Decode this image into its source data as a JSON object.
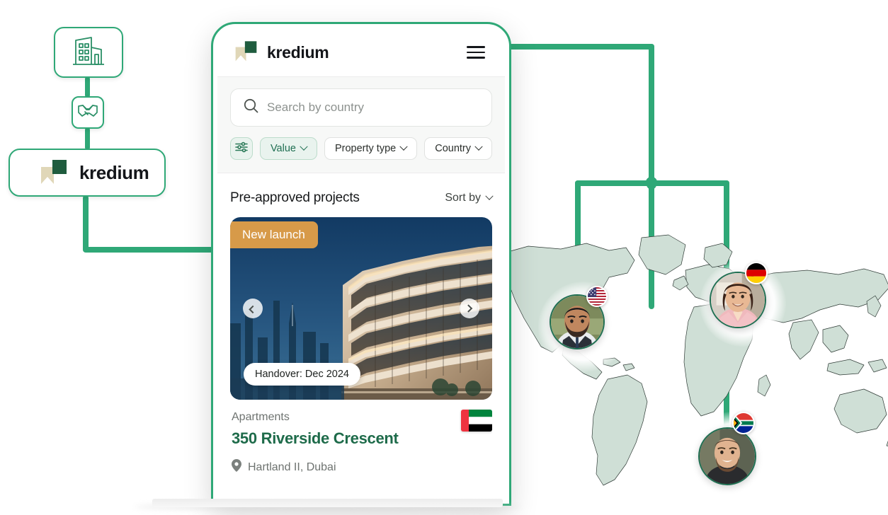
{
  "brand": {
    "name": "kredium",
    "accent": "#2fa877",
    "logo_dark": "#1f5c3e",
    "logo_light": "#e3dbbf"
  },
  "diagram": {
    "nodes": [
      {
        "id": "building",
        "icon": "office-building-icon",
        "label": ""
      },
      {
        "id": "deal",
        "icon": "handshake-icon",
        "label": ""
      },
      {
        "id": "kredium",
        "icon": "kredium-logo-icon",
        "label": "kredium"
      }
    ]
  },
  "phone": {
    "header": {
      "brand": "kredium",
      "menu_icon": "hamburger-menu-icon"
    },
    "search": {
      "placeholder": "Search by country",
      "value": "",
      "icon": "search-icon"
    },
    "filters": {
      "settings_icon": "filter-sliders-icon",
      "chips": [
        {
          "label": "Value",
          "active": true
        },
        {
          "label": "Property type",
          "active": false
        },
        {
          "label": "Country",
          "active": false
        }
      ]
    },
    "section": {
      "title": "Pre-approved projects",
      "sort_label": "Sort by"
    },
    "card": {
      "badge": "New launch",
      "favorite_icon": "heart-icon",
      "prev_icon": "chevron-left-icon",
      "next_icon": "chevron-right-icon",
      "handover": "Handover: Dec 2024",
      "property_type": "Apartments",
      "title": "350 Riverside Crescent",
      "location": "Hartland II, Dubai",
      "location_icon": "map-pin-icon",
      "flag": "united-arab-emirates-flag"
    }
  },
  "map": {
    "markers": [
      {
        "id": "north-america",
        "flag": "united-states-flag",
        "flag_name": "USA"
      },
      {
        "id": "europe",
        "flag": "germany-flag",
        "flag_name": "Germany"
      },
      {
        "id": "africa",
        "flag": "south-africa-flag",
        "flag_name": "South Africa"
      }
    ]
  }
}
